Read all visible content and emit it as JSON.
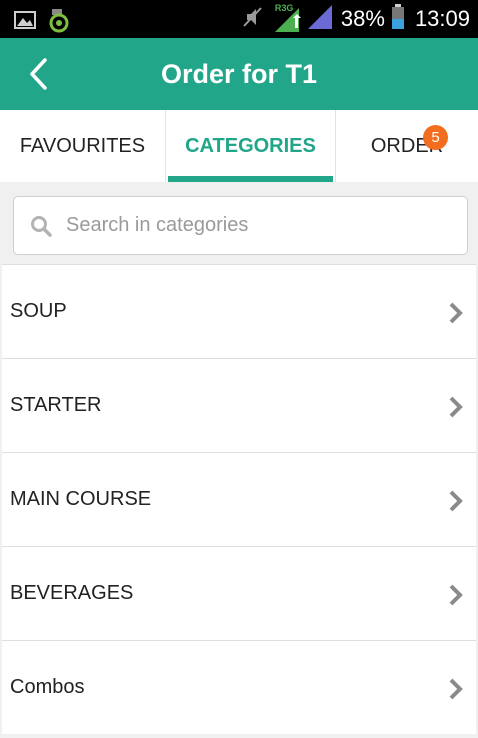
{
  "status_bar": {
    "network_label": "R3G",
    "battery_percent": "38%",
    "time": "13:09"
  },
  "app_bar": {
    "title": "Order for T1"
  },
  "tabs": [
    {
      "label": "FAVOURITES"
    },
    {
      "label": "CATEGORIES",
      "active": true
    },
    {
      "label": "ORDER",
      "badge": "5"
    }
  ],
  "search": {
    "placeholder": "Search in categories",
    "value": ""
  },
  "categories": [
    {
      "label": "SOUP"
    },
    {
      "label": "STARTER"
    },
    {
      "label": "MAIN COURSE"
    },
    {
      "label": "BEVERAGES"
    },
    {
      "label": "Combos"
    }
  ],
  "colors": {
    "primary": "#21a68a",
    "badge": "#f36d1f",
    "background": "#f0f0f0"
  },
  "icons": [
    "image-icon",
    "app-icon",
    "muted-icon",
    "signal-icon",
    "battery-icon",
    "back-arrow-icon",
    "search-icon",
    "chevron-right-icon"
  ]
}
